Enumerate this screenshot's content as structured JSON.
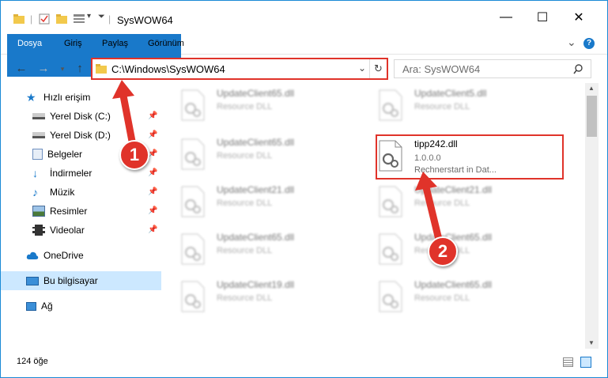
{
  "window": {
    "title": "SysWOW64",
    "minimize_label": "—",
    "maximize_label": "☐",
    "close_label": "✕"
  },
  "ribbon": {
    "tabs": [
      {
        "label": "Dosya"
      },
      {
        "label": "Giriş"
      },
      {
        "label": "Paylaş"
      },
      {
        "label": "Görünüm"
      }
    ],
    "collapse_label": "⌄",
    "help_label": "?"
  },
  "address": {
    "path": "C:\\Windows\\SysWOW64",
    "search_placeholder": "Ara: SysWOW64"
  },
  "nav": {
    "items": [
      {
        "label": "Hızlı erişim"
      },
      {
        "label": "Yerel Disk (C:)"
      },
      {
        "label": "Yerel Disk (D:)"
      },
      {
        "label": "Belgeler"
      },
      {
        "label": "İndirmeler"
      },
      {
        "label": "Müzik"
      },
      {
        "label": "Resimler"
      },
      {
        "label": "Videolar"
      },
      {
        "label": "OneDrive"
      },
      {
        "label": "Bu bilgisayar"
      },
      {
        "label": "Ağ"
      }
    ]
  },
  "files": [
    {
      "name": "UpdateClient65.dll",
      "desc": "Resource DLL"
    },
    {
      "name": "UpdateClient5.dll",
      "desc": "Resource DLL"
    },
    {
      "name": "UpdateClient65.dll",
      "desc": "Resource DLL"
    },
    {
      "name": "UpdateClient21.dll",
      "desc": "Resource DLL"
    },
    {
      "name": "UpdateClient21.dll",
      "desc": "Resource DLL"
    },
    {
      "name": "UpdateClient65.dll",
      "desc": "Resource DLL"
    },
    {
      "name": "UpdateClient65.dll",
      "desc": "Resource DLL"
    },
    {
      "name": "UpdateClient19.dll",
      "desc": "Resource DLL"
    },
    {
      "name": "UpdateClient65.dll",
      "desc": "Resource DLL"
    }
  ],
  "highlighted_file": {
    "name": "tipp242.dll",
    "version": "1.0.0.0",
    "company": "Rechnerstart in Dat..."
  },
  "status": {
    "count": "124 öğe"
  },
  "callouts": {
    "one": "1",
    "two": "2"
  },
  "colors": {
    "accent": "#1979ca",
    "annotation": "#e0332a",
    "selected": "#cce8ff"
  }
}
